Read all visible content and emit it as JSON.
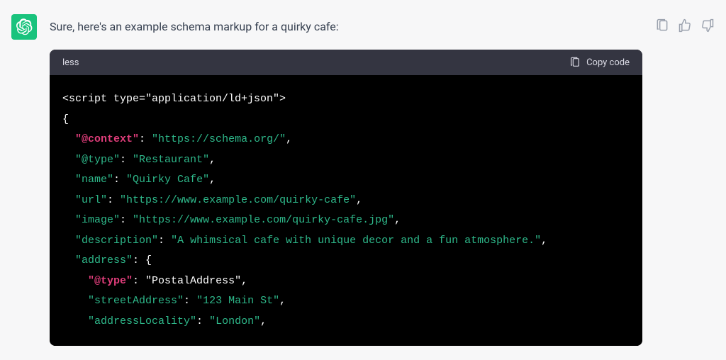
{
  "intro": "Sure, here's an example schema markup for a quirky cafe:",
  "code_header": {
    "language": "less",
    "copy_label": "Copy code"
  },
  "code": {
    "line1": "<script type=\"application/ld+json\">",
    "line2": "{",
    "l3_key": "\"@context\"",
    "l3_colon": ": ",
    "l3_val": "\"https://schema.org/\"",
    "l3_end": ",",
    "l4_key": "\"@type\"",
    "l4_val": "\"Restaurant\"",
    "l4_end": ",",
    "l5_key": "\"name\"",
    "l5_val": "\"Quirky Cafe\"",
    "l5_end": ",",
    "l6_key": "\"url\"",
    "l6_val": "\"https://www.example.com/quirky-cafe\"",
    "l6_end": ",",
    "l7_key": "\"image\"",
    "l7_val": "\"https://www.example.com/quirky-cafe.jpg\"",
    "l7_end": ",",
    "l8_key": "\"description\"",
    "l8_val": "\"A whimsical cafe with unique decor and a fun atmosphere.\"",
    "l8_end": ",",
    "l9_key": "\"address\"",
    "l9_val": ": {",
    "l10_key": "\"@type\"",
    "l10_val": "\"PostalAddress\"",
    "l10_end": ",",
    "l11_key": "\"streetAddress\"",
    "l11_val": "\"123 Main St\"",
    "l11_end": ",",
    "l12_key": "\"addressLocality\"",
    "l12_val": "\"London\"",
    "l12_end": ","
  }
}
